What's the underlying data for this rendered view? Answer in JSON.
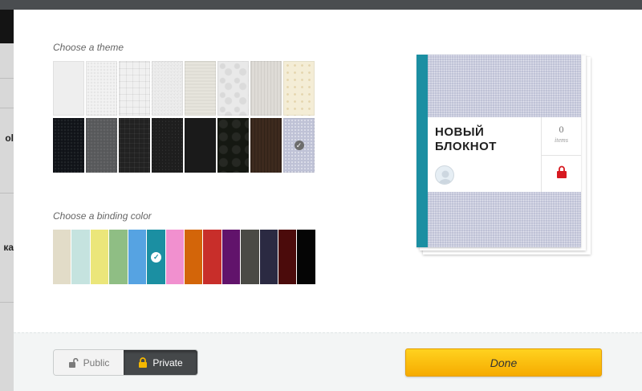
{
  "backdrop": {
    "text_fragments": [
      "ol",
      "ка"
    ]
  },
  "theme_section": {
    "label": "Choose a theme",
    "tiles": [
      {
        "name": "white-plain",
        "color": "#eeeeee"
      },
      {
        "name": "white-texture",
        "color": "#f2f2f2"
      },
      {
        "name": "white-grid",
        "color": "#f0f0f0"
      },
      {
        "name": "white-diagonal",
        "color": "#ececec"
      },
      {
        "name": "beige-linen",
        "color": "#e6e4dc"
      },
      {
        "name": "white-floral",
        "color": "#e9e9e9"
      },
      {
        "name": "wood-light",
        "color": "#dedbd6"
      },
      {
        "name": "cream-dots",
        "color": "#f4edd6"
      },
      {
        "name": "black-leather",
        "color": "#101318"
      },
      {
        "name": "grey-felt",
        "color": "#57585a"
      },
      {
        "name": "black-mesh",
        "color": "#222222"
      },
      {
        "name": "black-pinstripe",
        "color": "#1e1e1e"
      },
      {
        "name": "black-plain",
        "color": "#1a1a1a"
      },
      {
        "name": "black-damask",
        "color": "#151812"
      },
      {
        "name": "dark-wood",
        "color": "#3d2a1e"
      },
      {
        "name": "lavender-dots",
        "color": "#bfc2d6"
      }
    ],
    "selected_index": 15
  },
  "binding_section": {
    "label": "Choose a binding color",
    "colors": [
      "#e2dcc8",
      "#c5e3df",
      "#ebe67a",
      "#8fbe84",
      "#56a3e2",
      "#1b8fa2",
      "#f190cf",
      "#d36509",
      "#c82e2a",
      "#61136b",
      "#4a4a45",
      "#2b2a42",
      "#4b0b0b",
      "#050505"
    ],
    "selected_index": 5
  },
  "preview": {
    "title": "НОВЫЙ БЛОКНОТ",
    "item_count": "0",
    "item_count_label": "items",
    "spine_color": "#1b8fa2",
    "cover_color": "#bfc2d6",
    "lock_color": "#d71920"
  },
  "footer": {
    "public_label": "Public",
    "private_label": "Private",
    "active": "private",
    "done_label": "Done"
  }
}
